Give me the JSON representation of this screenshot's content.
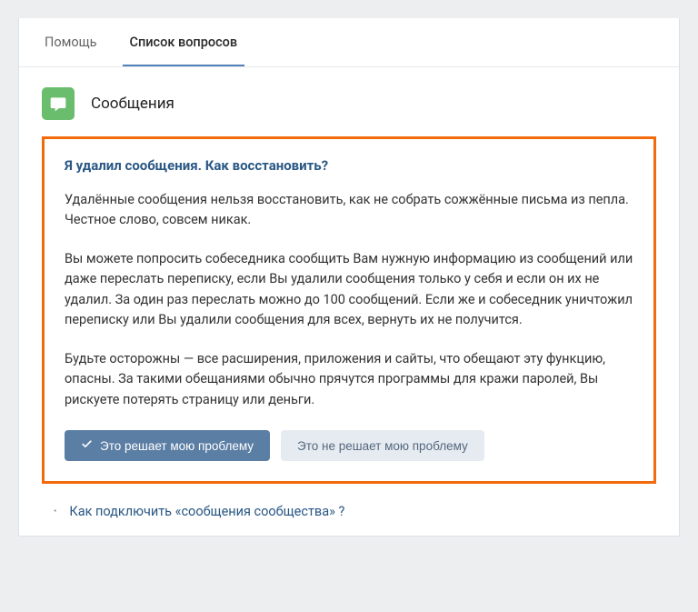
{
  "tabs": {
    "help": "Помощь",
    "questions": "Список вопросов"
  },
  "section": {
    "title": "Сообщения"
  },
  "article": {
    "title": "Я удалил сообщения. Как восстановить?",
    "p1": "Удалённые сообщения нельзя восстановить, как не собрать сожжённые письма из пепла. Честное слово, совсем никак.",
    "p2": "Вы можете попросить собеседника сообщить Вам нужную информацию из сообщений или даже переслать переписку, если Вы удалили сообщения только у себя и если он их не удалил. За один раз переслать можно до 100 сообщений. Если же и собеседник уничтожил переписку или Вы удалили сообщения для всех, вернуть их не получится.",
    "p3": "Будьте осторожны — все расширения, приложения и сайты, что обещают эту функцию, опасны. За такими обещаниями обычно прячутся программы для кражи паролей, Вы рискуете потерять страницу или деньги."
  },
  "actions": {
    "solves": "Это решает мою проблему",
    "not_solves": "Это не решает мою проблему"
  },
  "related": {
    "link1": "Как подключить «сообщения сообщества» ?"
  }
}
